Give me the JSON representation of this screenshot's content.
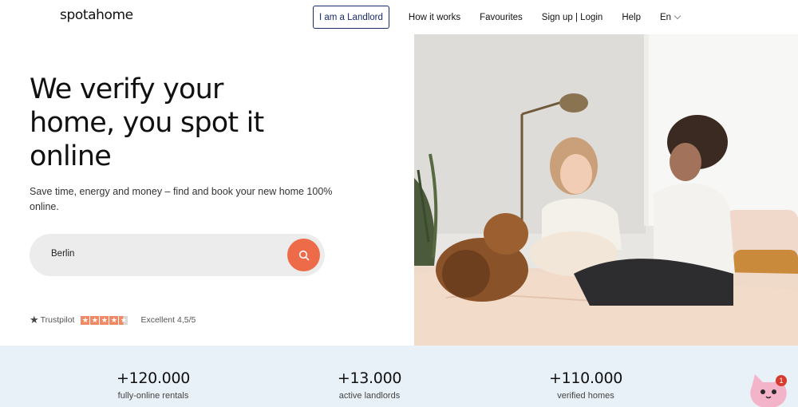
{
  "header": {
    "logo": "spotahome",
    "landlord_label": "I am a Landlord",
    "nav": [
      "How it works",
      "Favourites",
      "Sign up | Login",
      "Help"
    ],
    "language": "En"
  },
  "hero": {
    "headline": [
      "We verify your",
      "home, you spot it",
      "online"
    ],
    "subtext": "Save time, energy and money – find and book your new home 100% online.",
    "search_value": "Berlin",
    "trustpilot": {
      "label": "Trustpilot",
      "stars": 4.5,
      "rating": "Excellent 4,5/5"
    }
  },
  "stats": [
    {
      "value": "+120.000",
      "label": "fully-online rentals"
    },
    {
      "value": "+13.000",
      "label": "active landlords"
    },
    {
      "value": "+110.000",
      "label": "verified homes"
    }
  ],
  "chat": {
    "badge": "1"
  },
  "colors": {
    "accent": "#ee6b4a",
    "landlord_border": "#1a2b6b",
    "stats_bg": "#e8f0f8"
  },
  "icons": [
    "search-icon",
    "chevron-down-icon",
    "trustpilot-star-icon",
    "chat-cat-icon"
  ]
}
